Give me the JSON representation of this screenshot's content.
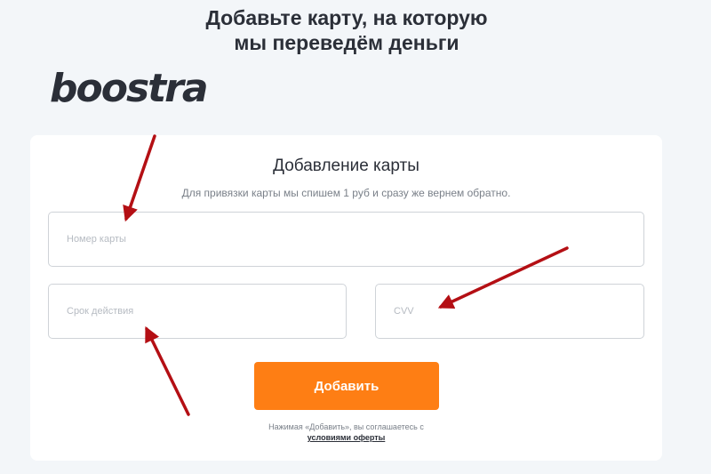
{
  "page": {
    "headline_line1": "Добавьте карту, на которую",
    "headline_line2": "мы переведём деньги"
  },
  "brand": {
    "logo_text": "boostra"
  },
  "card": {
    "title": "Добавление карты",
    "subtitle": "Для привязки карты мы спишем 1 руб и сразу же вернем обратно.",
    "fields": {
      "number_placeholder": "Номер карты",
      "expiry_placeholder": "Срок действия",
      "cvv_placeholder": "CVV"
    },
    "submit_label": "Добавить",
    "agreement_text": "Нажимая «Добавить», вы соглашаетесь с",
    "agreement_link": "условиями оферты"
  },
  "colors": {
    "accent": "#fe7e14",
    "annotation_arrow": "#b40f14",
    "background": "#f3f6f9"
  },
  "annotations": {
    "arrows": [
      "arrow-to-card-number",
      "arrow-to-expiry",
      "arrow-to-cvv"
    ]
  }
}
